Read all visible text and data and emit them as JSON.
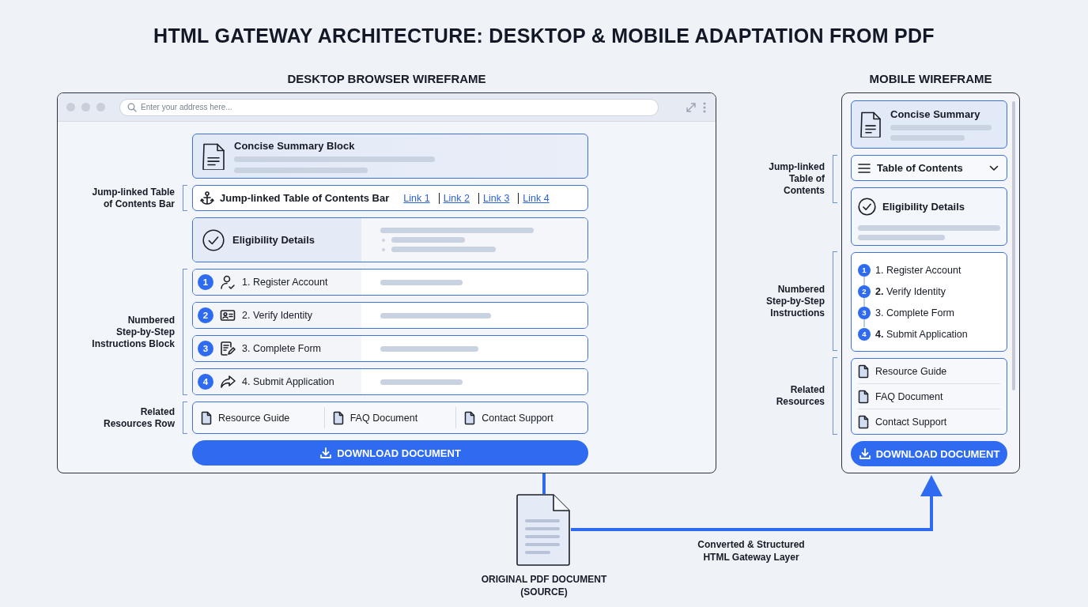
{
  "title": "HTML GATEWAY ARCHITECTURE: DESKTOP & MOBILE ADAPTATION FROM PDF",
  "desktop": {
    "heading": "DESKTOP BROWSER WIREFRAME",
    "address_placeholder": "Enter your address here...",
    "summary": {
      "title": "Concise Summary Block"
    },
    "toc": {
      "annotation": [
        "Jump-linked Table",
        "of Contents Bar"
      ],
      "title": "Jump-linked Table of Contents Bar",
      "links": [
        "Link 1",
        "Link 2",
        "Link 3",
        "Link 4"
      ]
    },
    "eligibility": {
      "title": "Eligibility Details"
    },
    "steps_annotation": [
      "Numbered",
      "Step-by-Step",
      "Instructions Block"
    ],
    "steps": [
      {
        "number": "1",
        "label": "1. Register Account",
        "kind": "user"
      },
      {
        "number": "2",
        "label": "2. Verify Identity",
        "kind": "id"
      },
      {
        "number": "3",
        "label": "3. Complete Form",
        "kind": "form"
      },
      {
        "number": "4",
        "label": "4. Submit Application",
        "kind": "share"
      }
    ],
    "resources_annotation": [
      "Related",
      "Resources Row"
    ],
    "resources": [
      "Resource Guide",
      "FAQ Document",
      "Contact Support"
    ],
    "download": "DOWNLOAD DOCUMENT"
  },
  "mobile": {
    "heading": "MOBILE WIREFRAME",
    "summary": {
      "title": "Concise Summary"
    },
    "toc": {
      "annotation": [
        "Jump-linked",
        "Table of",
        "Contents"
      ],
      "title": "Table of Contents"
    },
    "eligibility": {
      "title": "Eligibility Details"
    },
    "steps_annotation": [
      "Numbered",
      "Step-by-Step",
      "Instructions"
    ],
    "steps": [
      {
        "number": "1",
        "label": "1. Register Account"
      },
      {
        "number": "2",
        "label": "**2.** Verify Identity"
      },
      {
        "number": "3",
        "label": "3. Complete Form"
      },
      {
        "number": "4",
        "label": "**4.** Submit Application"
      }
    ],
    "resources_annotation": [
      "Related",
      "Resources"
    ],
    "resources": [
      "Resource Guide",
      "FAQ Document",
      "Contact Support"
    ],
    "download": "DOWNLOAD DOCUMENT"
  },
  "source": {
    "caption": [
      "ORIGINAL PDF DOCUMENT",
      "(SOURCE)"
    ]
  },
  "connector_label": [
    "Converted & Structured",
    "HTML Gateway Layer"
  ]
}
